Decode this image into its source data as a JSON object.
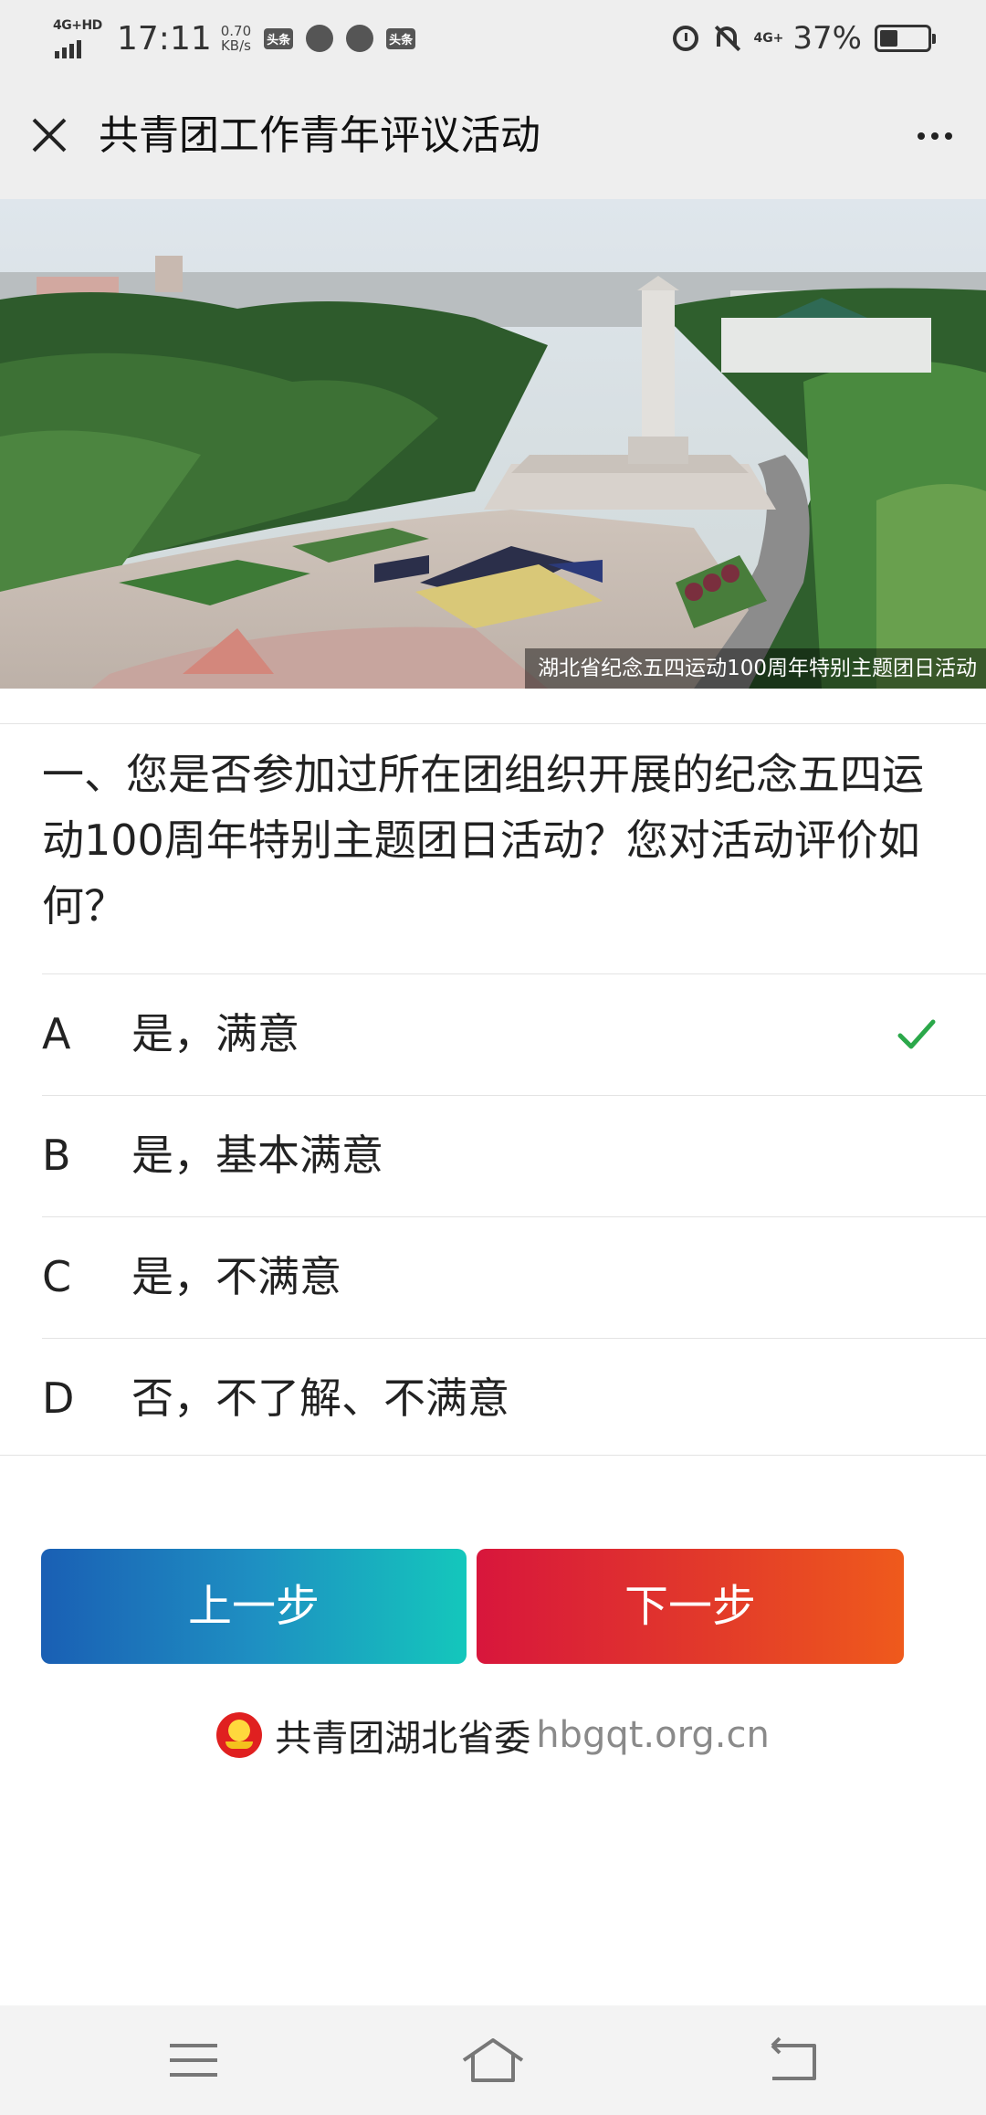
{
  "status_bar": {
    "network": "4G+HD",
    "time": "17:11",
    "speed_value": "0.70",
    "speed_unit": "KB/s",
    "badge1": "头条",
    "badge2": "头条",
    "network_right": "4G+",
    "battery_percent": "37%",
    "battery_level": 0.37
  },
  "nav": {
    "title": "共青团工作青年评议活动"
  },
  "banner": {
    "caption": "湖北省纪念五四运动100周年特别主题团日活动"
  },
  "question": {
    "text": "一、您是否参加过所在团组织开展的纪念五四运动100周年特别主题团日活动？您对活动评价如何？"
  },
  "options": [
    {
      "letter": "A",
      "text": "是，满意",
      "selected": true
    },
    {
      "letter": "B",
      "text": "是，基本满意",
      "selected": false
    },
    {
      "letter": "C",
      "text": "是，不满意",
      "selected": false
    },
    {
      "letter": "D",
      "text": "否，不了解、不满意",
      "selected": false
    }
  ],
  "buttons": {
    "prev_label": "上一步",
    "next_label": "下一步"
  },
  "footer": {
    "org": "共青团湖北省委",
    "url": "hbgqt.org.cn"
  },
  "colors": {
    "check": "#2ba84a",
    "prev_start": "#1a5fb4",
    "prev_end": "#14c7bc",
    "next_start": "#d8163c",
    "next_end": "#ef5a1c"
  }
}
